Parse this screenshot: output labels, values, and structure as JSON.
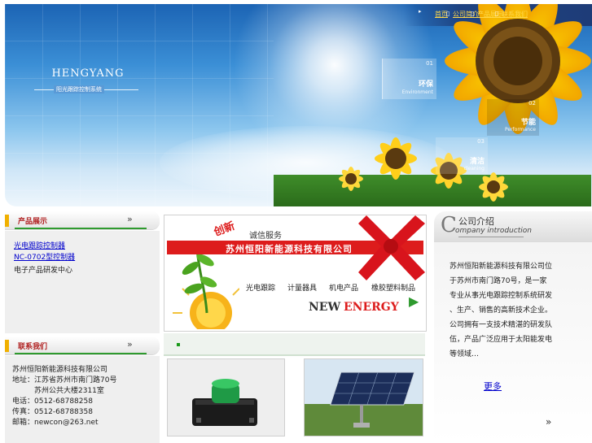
{
  "nav": {
    "arrow": "▸",
    "items": [
      "首页",
      "公司简介",
      "产品展示",
      "联系我们"
    ],
    "separator": "▯"
  },
  "banner": {
    "brand": "HENGYANG",
    "subtitle": "阳光跟踪控制系统",
    "features": [
      {
        "num": "01",
        "cn": "环保",
        "en": "Environment"
      },
      {
        "num": "02",
        "cn": "节能",
        "en": "Performance"
      },
      {
        "num": "03",
        "cn": "清洁",
        "en": "cleaning"
      }
    ]
  },
  "products": {
    "header": "产品展示",
    "chevron": "»",
    "links": [
      "光电跟踪控制器",
      "NC-0702型控制器"
    ],
    "text": "电子产品研发中心"
  },
  "contact": {
    "header": "联系我们",
    "chevron": "»",
    "lines": [
      "苏州恒阳新能源科技有限公司",
      "地址：江苏省苏州市南门路70号",
      "　　　苏州公共大楼2311室",
      "电话：0512-68788258",
      "传真：0512-68788358",
      "邮箱：newcon@263.net"
    ]
  },
  "promo": {
    "chuangxin": "创新",
    "chengxin": "诚信服务",
    "company": "苏州恒阳新能源科技有限公司",
    "categories": [
      "光电跟踪",
      "计量器具",
      "机电产品",
      "橡胶塑料制品"
    ],
    "new_word": "NEW",
    "energy_word": "ENERGY",
    "arrow": "▶"
  },
  "about": {
    "letter": "C",
    "title_cn": "公司介绍",
    "title_en": "ompany introduction",
    "lines": [
      "苏州恒阳新能源科技有限公司位",
      "于苏州市南门路70号，是一家",
      "专业从事光电跟踪控制系统研发",
      "、生产、销售的高新技术企业。",
      "公司拥有一支技术精湛的研发队",
      "伍，产品广泛应用于太阳能发电",
      "等领域…"
    ],
    "more": "更多",
    "chevron": "»"
  },
  "colors": {
    "accent_red": "#dd1c1c",
    "link_blue": "#0000cc",
    "nav_yellow": "#ffd84a",
    "brand_green": "#2e9a2e"
  }
}
